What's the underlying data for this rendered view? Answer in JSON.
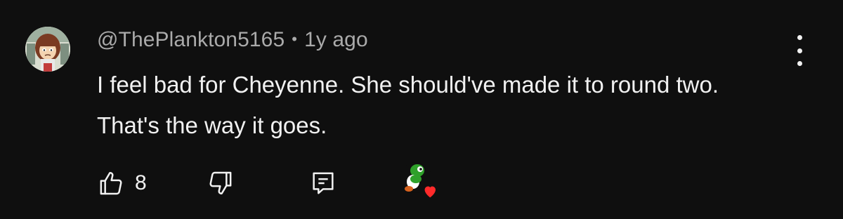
{
  "comment": {
    "author": "@ThePlankton5165",
    "separator": "•",
    "timestamp": "1y ago",
    "text": "I feel bad for Cheyenne. She should've made it to round two. That's the way it goes."
  },
  "actions": {
    "like_count": "8",
    "like_icon": "thumbs-up-icon",
    "dislike_icon": "thumbs-down-icon",
    "reply_icon": "reply-icon",
    "menu_icon": "more-vertical-icon",
    "heart_icon": "creator-heart-icon"
  },
  "colors": {
    "background": "#0f0f0f",
    "text": "#f1f1f1",
    "meta_text": "#aaaaaa",
    "heart": "#ff2a2a"
  }
}
